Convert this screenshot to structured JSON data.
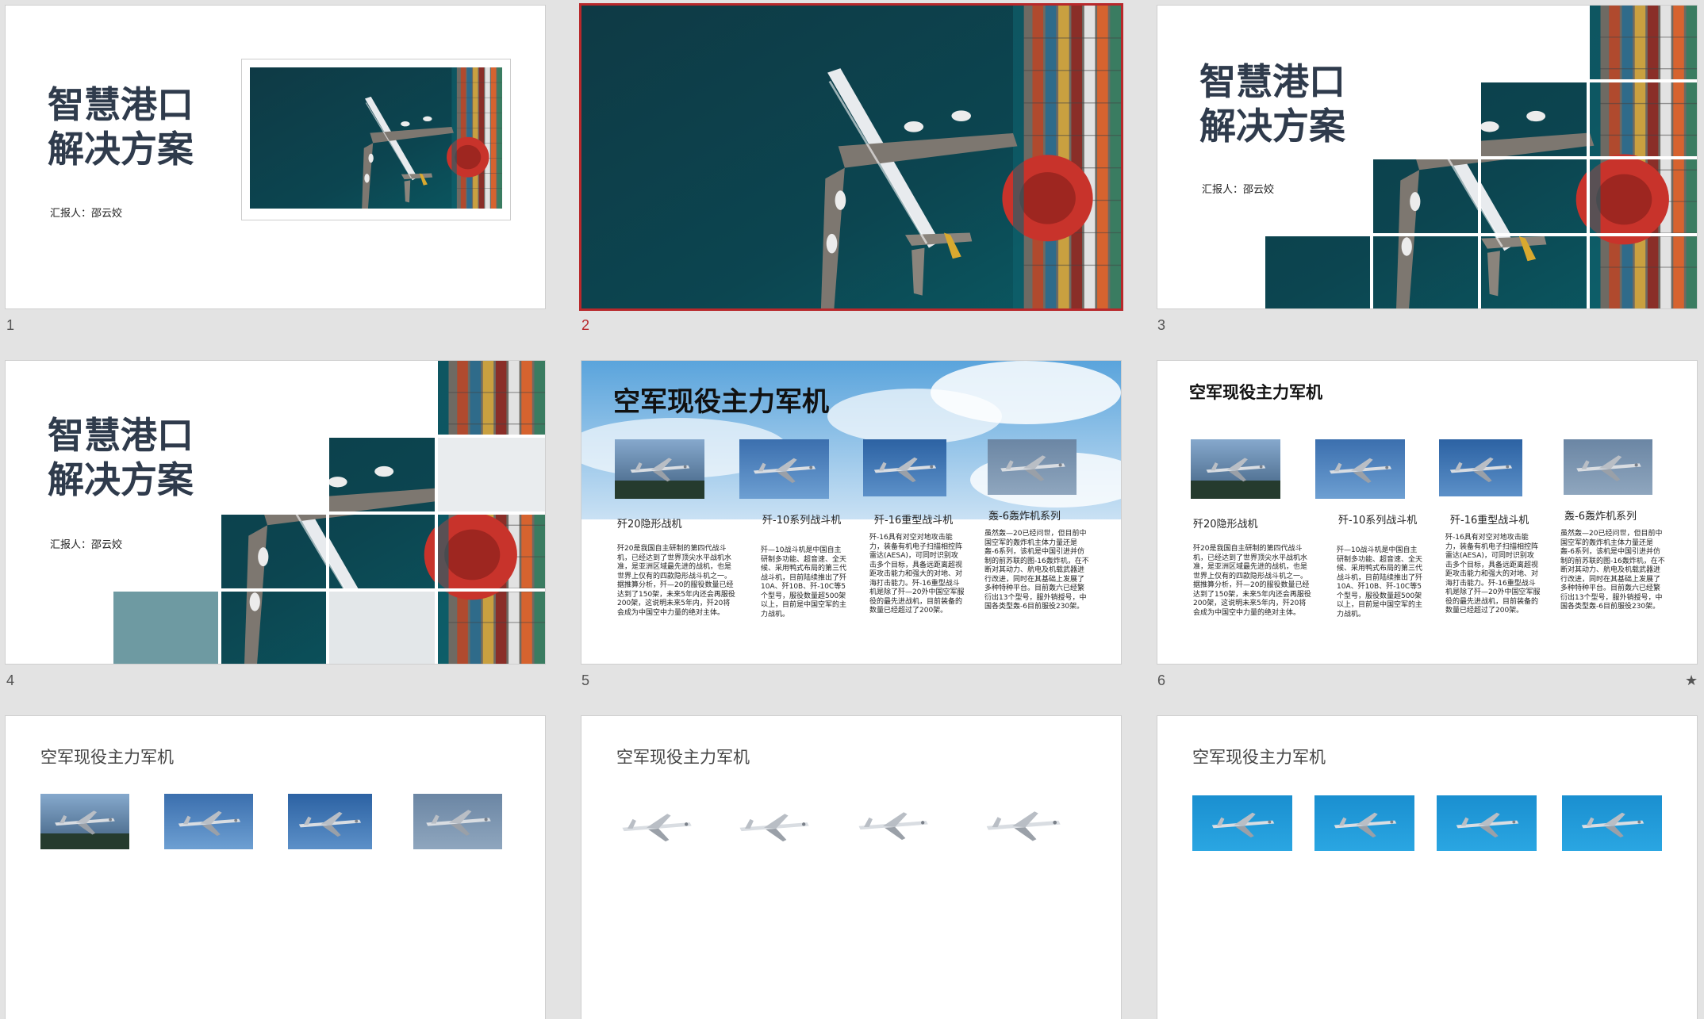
{
  "slide_numbers": [
    "1",
    "2",
    "3",
    "4",
    "5",
    "6"
  ],
  "cover": {
    "title": "智慧港口\n解决方案",
    "reporter": "汇报人：邵云姣"
  },
  "aircraft": {
    "title": "空军现役主力军机",
    "items": [
      {
        "name": "歼20隐形战机",
        "desc": "歼20是我国自主研制的第四代战斗机，已经达到了世界顶尖水平战机水准，是亚洲区域最先进的战机，也是世界上仅有的四款隐形战斗机之一。据推算分析，歼—20的服役数量已经达到了150架，未来5年内还会再服役200架，这说明未来5年内，歼20将会成为中国空中力量的绝对主体。"
      },
      {
        "name": "歼-10系列战斗机",
        "desc": "歼—10战斗机是中国自主研制多功能、超音速、全天候、采用鸭式布局的第三代战斗机，目前陆续推出了歼10A、歼10B、歼-10C等5个型号，服役数量超500架以上，目前是中国空军的主力战机。"
      },
      {
        "name": "歼-16重型战斗机",
        "desc": "歼-16具有对空对地攻击能力，装备有机电子扫描相控阵雷达(AESA)，可同时识别攻击多个目标，具备远距离超视距攻击能力和强大的对地、对海打击能力。歼-16重型战斗机是除了歼—20外中国空军服役的最先进战机，目前装备的数量已经超过了200架。"
      },
      {
        "name": "轰-6轰炸机系列",
        "desc": "虽然轰—20已经问世，但目前中国空军的轰炸机主体力量还是轰-6系列，该机是中国引进并仿制的前苏联的图-16轰炸机，在不断对其动力、航电及机载武器进行改进，同时在其基础上发展了多种特种平台。目前轰六已经繁衍出13个型号，服外销授号，中国各类型轰-6目前服役230架。"
      }
    ]
  },
  "star": "★"
}
